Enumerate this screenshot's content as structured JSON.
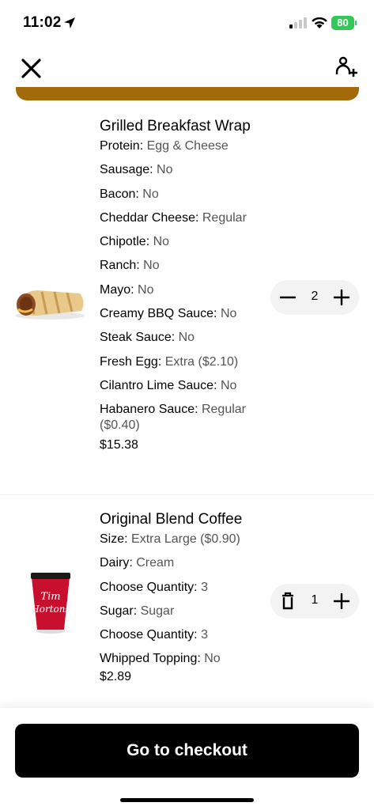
{
  "status_bar": {
    "time": "11:02",
    "battery_level": "80",
    "battery_color": "#33c759"
  },
  "header": {
    "close_icon": "close-icon",
    "add_person_icon": "add-person-icon",
    "brand_band_color": "#a26a08"
  },
  "items": [
    {
      "title": "Grilled Breakfast Wrap",
      "image_icon": "breakfast-wrap-image",
      "options": [
        {
          "key": "Protein:",
          "value": " Egg & Cheese"
        },
        {
          "key": "Sausage:",
          "value": " No"
        },
        {
          "key": "Bacon:",
          "value": " No"
        },
        {
          "key": "Cheddar Cheese:",
          "value": " Regular"
        },
        {
          "key": "Chipotle:",
          "value": " No"
        },
        {
          "key": "Ranch:",
          "value": " No"
        },
        {
          "key": "Mayo:",
          "value": " No"
        },
        {
          "key": "Creamy BBQ Sauce:",
          "value": " No"
        },
        {
          "key": "Steak Sauce:",
          "value": " No"
        },
        {
          "key": "Fresh Egg:",
          "value": " Extra ($2.10)"
        },
        {
          "key": "Cilantro Lime Sauce:",
          "value": " No"
        },
        {
          "key": "Habanero Sauce:",
          "value": " Regular ($0.40)"
        }
      ],
      "price": "$15.38",
      "quantity": "2",
      "decrease_icon": "minus-icon",
      "increase_icon": "plus-icon"
    },
    {
      "title": "Original Blend Coffee",
      "image_icon": "coffee-cup-image",
      "options": [
        {
          "key": "Size:",
          "value": " Extra Large ($0.90)"
        },
        {
          "key": "Dairy:",
          "value": " Cream"
        },
        {
          "key": "Choose Quantity:",
          "value": " 3"
        },
        {
          "key": "Sugar:",
          "value": " Sugar"
        },
        {
          "key": "Choose Quantity:",
          "value": " 3"
        },
        {
          "key": "Whipped Topping:",
          "value": " No"
        }
      ],
      "price": "$2.89",
      "quantity": "1",
      "decrease_icon": "trash-icon",
      "increase_icon": "plus-icon"
    }
  ],
  "checkout": {
    "label": "Go to checkout"
  }
}
